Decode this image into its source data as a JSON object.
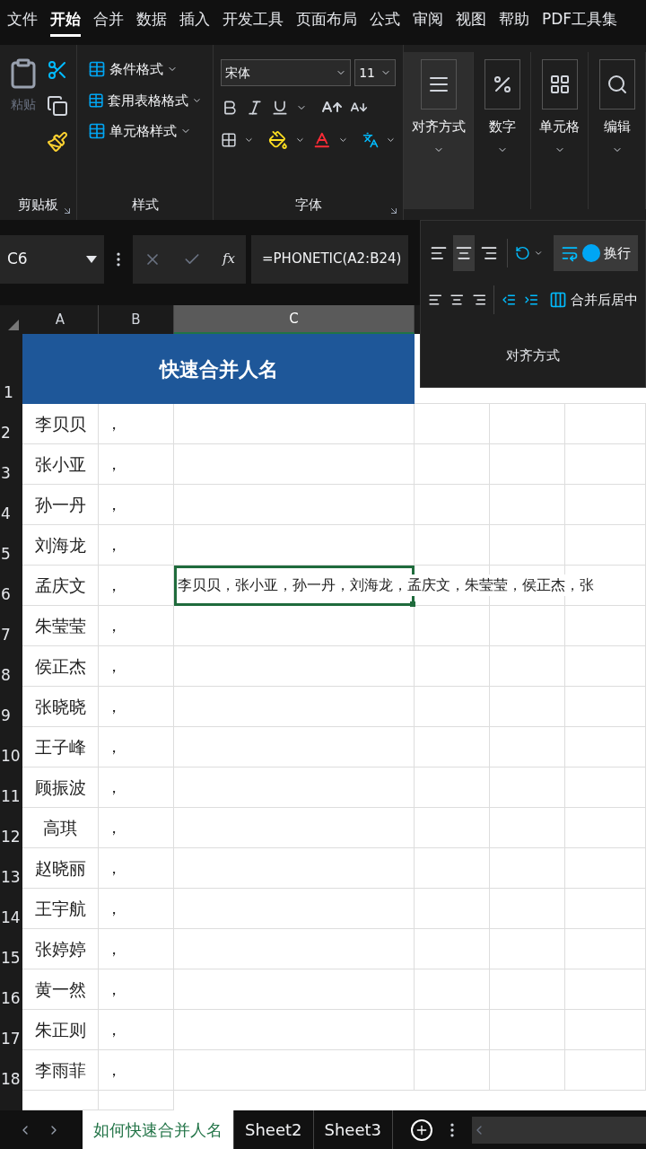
{
  "menu_tabs": [
    {
      "label": "文件",
      "selected": false
    },
    {
      "label": "开始",
      "selected": true
    },
    {
      "label": "合并",
      "selected": false
    },
    {
      "label": "数据",
      "selected": false
    },
    {
      "label": "插入",
      "selected": false
    },
    {
      "label": "开发工具",
      "selected": false
    },
    {
      "label": "页面布局",
      "selected": false
    },
    {
      "label": "公式",
      "selected": false
    },
    {
      "label": "审阅",
      "selected": false
    },
    {
      "label": "视图",
      "selected": false
    },
    {
      "label": "帮助",
      "selected": false
    },
    {
      "label": "PDF工具集",
      "selected": false
    }
  ],
  "ribbon": {
    "clipboard": {
      "paste_label": "粘贴",
      "group_label": "剪贴板"
    },
    "styles": {
      "items": [
        "条件格式",
        "套用表格格式",
        "单元格样式"
      ],
      "group_label": "样式"
    },
    "font": {
      "font_name": "宋体",
      "font_size": "11",
      "group_label": "字体"
    },
    "collapsed_groups": [
      {
        "label": "对齐方式",
        "selected": true
      },
      {
        "label": "数字",
        "selected": false
      },
      {
        "label": "单元格",
        "selected": false
      },
      {
        "label": "编辑",
        "selected": false
      }
    ]
  },
  "formula_bar": {
    "name_box": "C6",
    "function_label": "fx",
    "formula": "=PHONETIC(A2:B24)"
  },
  "alignment_panel": {
    "title": "对齐方式",
    "vertical_align": [
      {
        "selected": false
      },
      {
        "selected": true
      },
      {
        "selected": false
      }
    ],
    "wrap_label": "换行",
    "merge_label": "合并后居中"
  },
  "columns": [
    {
      "label": "A",
      "selected": false
    },
    {
      "label": "B",
      "selected": false
    },
    {
      "label": "C",
      "selected": true
    }
  ],
  "title_row_number": "1",
  "title": "快速合并人名",
  "rows": [
    {
      "number": "2",
      "name": "李贝贝",
      "sep": "，"
    },
    {
      "number": "3",
      "name": "张小亚",
      "sep": "，"
    },
    {
      "number": "4",
      "name": "孙一丹",
      "sep": "，"
    },
    {
      "number": "5",
      "name": "刘海龙",
      "sep": "，"
    },
    {
      "number": "6",
      "name": "孟庆文",
      "sep": "，",
      "result": "李贝贝，张小亚，孙一丹，刘海龙，孟庆文，朱莹莹，侯正杰，张",
      "selected": true
    },
    {
      "number": "7",
      "name": "朱莹莹",
      "sep": "，"
    },
    {
      "number": "8",
      "name": "侯正杰",
      "sep": "，"
    },
    {
      "number": "9",
      "name": "张晓晓",
      "sep": "，"
    },
    {
      "number": "10",
      "name": "王子峰",
      "sep": "，"
    },
    {
      "number": "11",
      "name": "顾振波",
      "sep": "，"
    },
    {
      "number": "12",
      "name": "高琪",
      "sep": "，"
    },
    {
      "number": "13",
      "name": "赵晓丽",
      "sep": "，"
    },
    {
      "number": "14",
      "name": "王宇航",
      "sep": "，"
    },
    {
      "number": "15",
      "name": "张婷婷",
      "sep": "，"
    },
    {
      "number": "16",
      "name": "黄一然",
      "sep": "，"
    },
    {
      "number": "17",
      "name": "朱正则",
      "sep": "，"
    },
    {
      "number": "18",
      "name": "李雨菲",
      "sep": "，"
    }
  ],
  "sheet_tabs": [
    {
      "label": "如何快速合并人名",
      "selected": true
    },
    {
      "label": "Sheet2",
      "selected": false
    },
    {
      "label": "Sheet3",
      "selected": false
    }
  ]
}
